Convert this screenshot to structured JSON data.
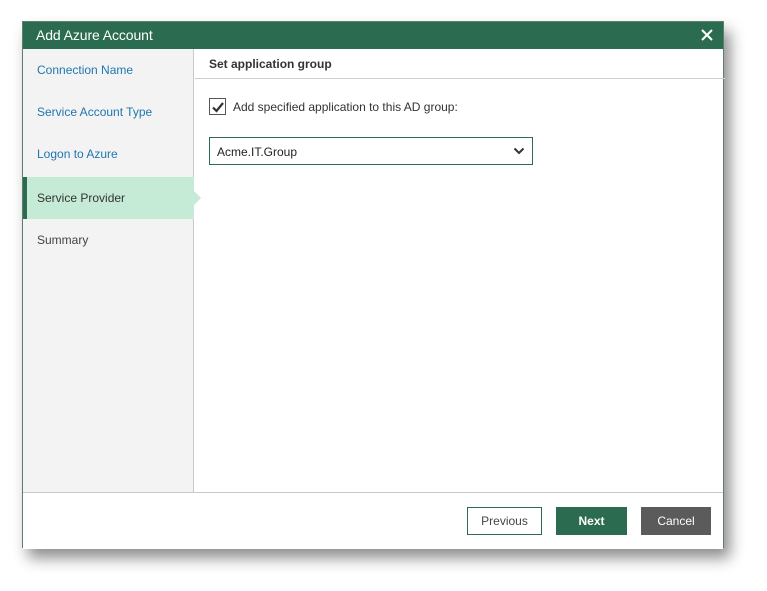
{
  "window": {
    "title": "Add Azure Account",
    "close_icon": "close-icon",
    "colors": {
      "titlebar": "#2b6c50",
      "active_nav": "#c5ead6",
      "link": "#1f76b0",
      "primary_button": "#2b6c50",
      "cancel_button": "#5b5b5b"
    }
  },
  "sidebar": {
    "items": [
      {
        "label": "Connection Name"
      },
      {
        "label": "Service Account Type"
      },
      {
        "label": "Logon to Azure"
      },
      {
        "label": "Service Provider"
      },
      {
        "label": "Summary"
      }
    ]
  },
  "main": {
    "section_title": "Set application group",
    "checkbox_label": "Add specified application to this AD group:",
    "checkbox_checked": true,
    "group_select": {
      "value": "Acme.IT.Group"
    }
  },
  "footer": {
    "previous_label": "Previous",
    "next_label": "Next",
    "cancel_label": "Cancel"
  }
}
